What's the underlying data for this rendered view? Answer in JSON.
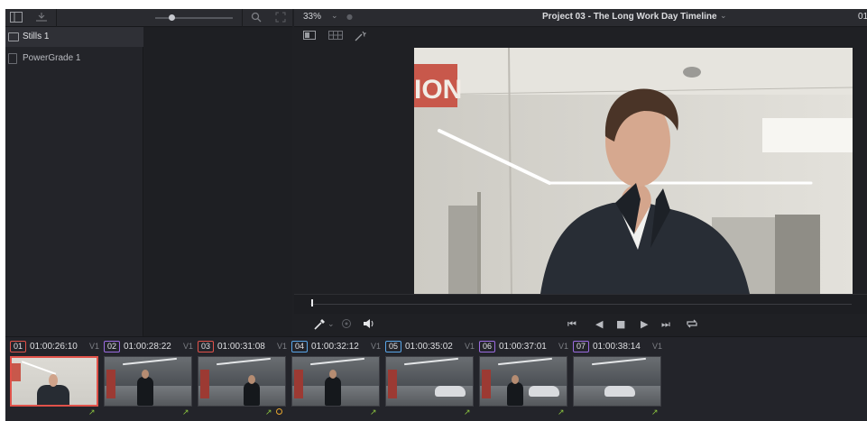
{
  "gallery": {
    "albums": [
      {
        "label": "Stills 1",
        "selected": true
      },
      {
        "label": "PowerGrade 1",
        "selected": false
      }
    ],
    "zoom_level": 0.17
  },
  "viewer": {
    "zoom": "33%",
    "project_title": "Project 03 - The Long Work Day Timeline",
    "timecode_partial": "01"
  },
  "frame_text": "ION",
  "timeline": {
    "clips": [
      {
        "num": "01",
        "timecode": "01:00:26:10",
        "track": "V1",
        "color": "#e0524a",
        "selected": true,
        "grade_marker": false,
        "scene": "office"
      },
      {
        "num": "02",
        "timecode": "01:00:28:22",
        "track": "V1",
        "color": "#9b6ce0",
        "selected": false,
        "grade_marker": false,
        "scene": "back"
      },
      {
        "num": "03",
        "timecode": "01:00:31:08",
        "track": "V1",
        "color": "#e0524a",
        "selected": false,
        "grade_marker": true,
        "scene": "walk"
      },
      {
        "num": "04",
        "timecode": "01:00:32:12",
        "track": "V1",
        "color": "#5aa6e8",
        "selected": false,
        "grade_marker": false,
        "scene": "front"
      },
      {
        "num": "05",
        "timecode": "01:00:35:02",
        "track": "V1",
        "color": "#5aa6e8",
        "selected": false,
        "grade_marker": false,
        "scene": "car"
      },
      {
        "num": "06",
        "timecode": "01:00:37:01",
        "track": "V1",
        "color": "#9b6ce0",
        "selected": false,
        "grade_marker": false,
        "scene": "cars"
      },
      {
        "num": "07",
        "timecode": "01:00:38:14",
        "track": "V1",
        "color": "#9b6ce0",
        "selected": false,
        "grade_marker": false,
        "scene": "car2"
      }
    ]
  }
}
